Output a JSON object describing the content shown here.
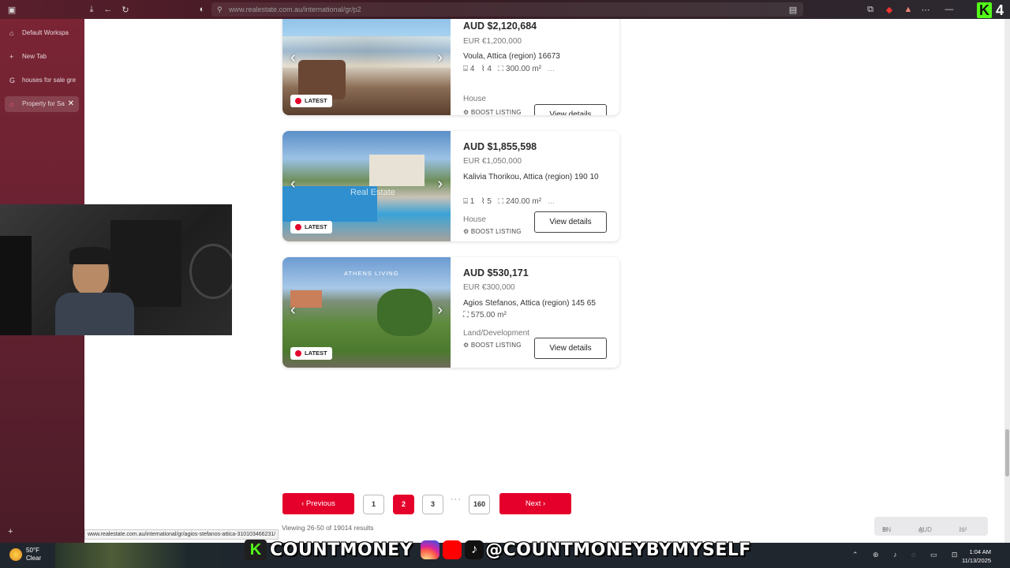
{
  "browser": {
    "url": "www.realestate.com.au/international/gr/p2",
    "workspace": "Default Workspa",
    "new_tab": "New Tab",
    "tabs": [
      {
        "label": "houses for sale gre"
      },
      {
        "label": "Property for Sa"
      }
    ],
    "status_url": "www.realestate.com.au/international/gr/agios-stefanos-attica-310103466231/"
  },
  "listings": [
    {
      "price_aud": "AUD $2,120,684",
      "price_eur": "EUR €1,200,000",
      "address": "Voula, Attica (region) 16673",
      "beds": "4",
      "baths": "4",
      "area": "300.00 m²",
      "more": "...",
      "type": "House",
      "badge": "LATEST",
      "boost": "BOOST LISTING",
      "button": "View details"
    },
    {
      "price_aud": "AUD $1,855,598",
      "price_eur": "EUR €1,050,000",
      "address": "Kalivia Thorikou, Attica (region) 190 10",
      "beds": "1",
      "baths": "5",
      "area": "240.00 m²",
      "more": "...",
      "type": "House",
      "badge": "LATEST",
      "boost": "BOOST LISTING",
      "button": "View details",
      "watermark": "Real Estate"
    },
    {
      "price_aud": "AUD $530,171",
      "price_eur": "EUR €300,000",
      "address": "Agios Stefanos, Attica (region) 145 65",
      "area": "575.00 m²",
      "type": "Land/Development",
      "badge": "LATEST",
      "boost": "BOOST LISTING",
      "button": "View details",
      "watermark": "ATHENS LIVING"
    }
  ],
  "pagination": {
    "previous": "Previous",
    "next": "Next",
    "pages": [
      "1",
      "2",
      "3"
    ],
    "current": "2",
    "ellipsis": "···",
    "last": "160",
    "results": "Viewing 26-50 of 19014 results"
  },
  "prefs": {
    "lang": "EN",
    "currency": "AUD",
    "unit": "m²"
  },
  "overlay": {
    "brand": "COUNTMONEY",
    "handle": "@COUNTMONEYBYMYSELF",
    "corner": "4"
  },
  "taskbar": {
    "temp": "50°F",
    "weather": "Clear",
    "time": "1:04 AM",
    "date": "11/13/2025"
  },
  "colors": {
    "accent": "#e4002b",
    "sidebar": "#7a2434"
  }
}
